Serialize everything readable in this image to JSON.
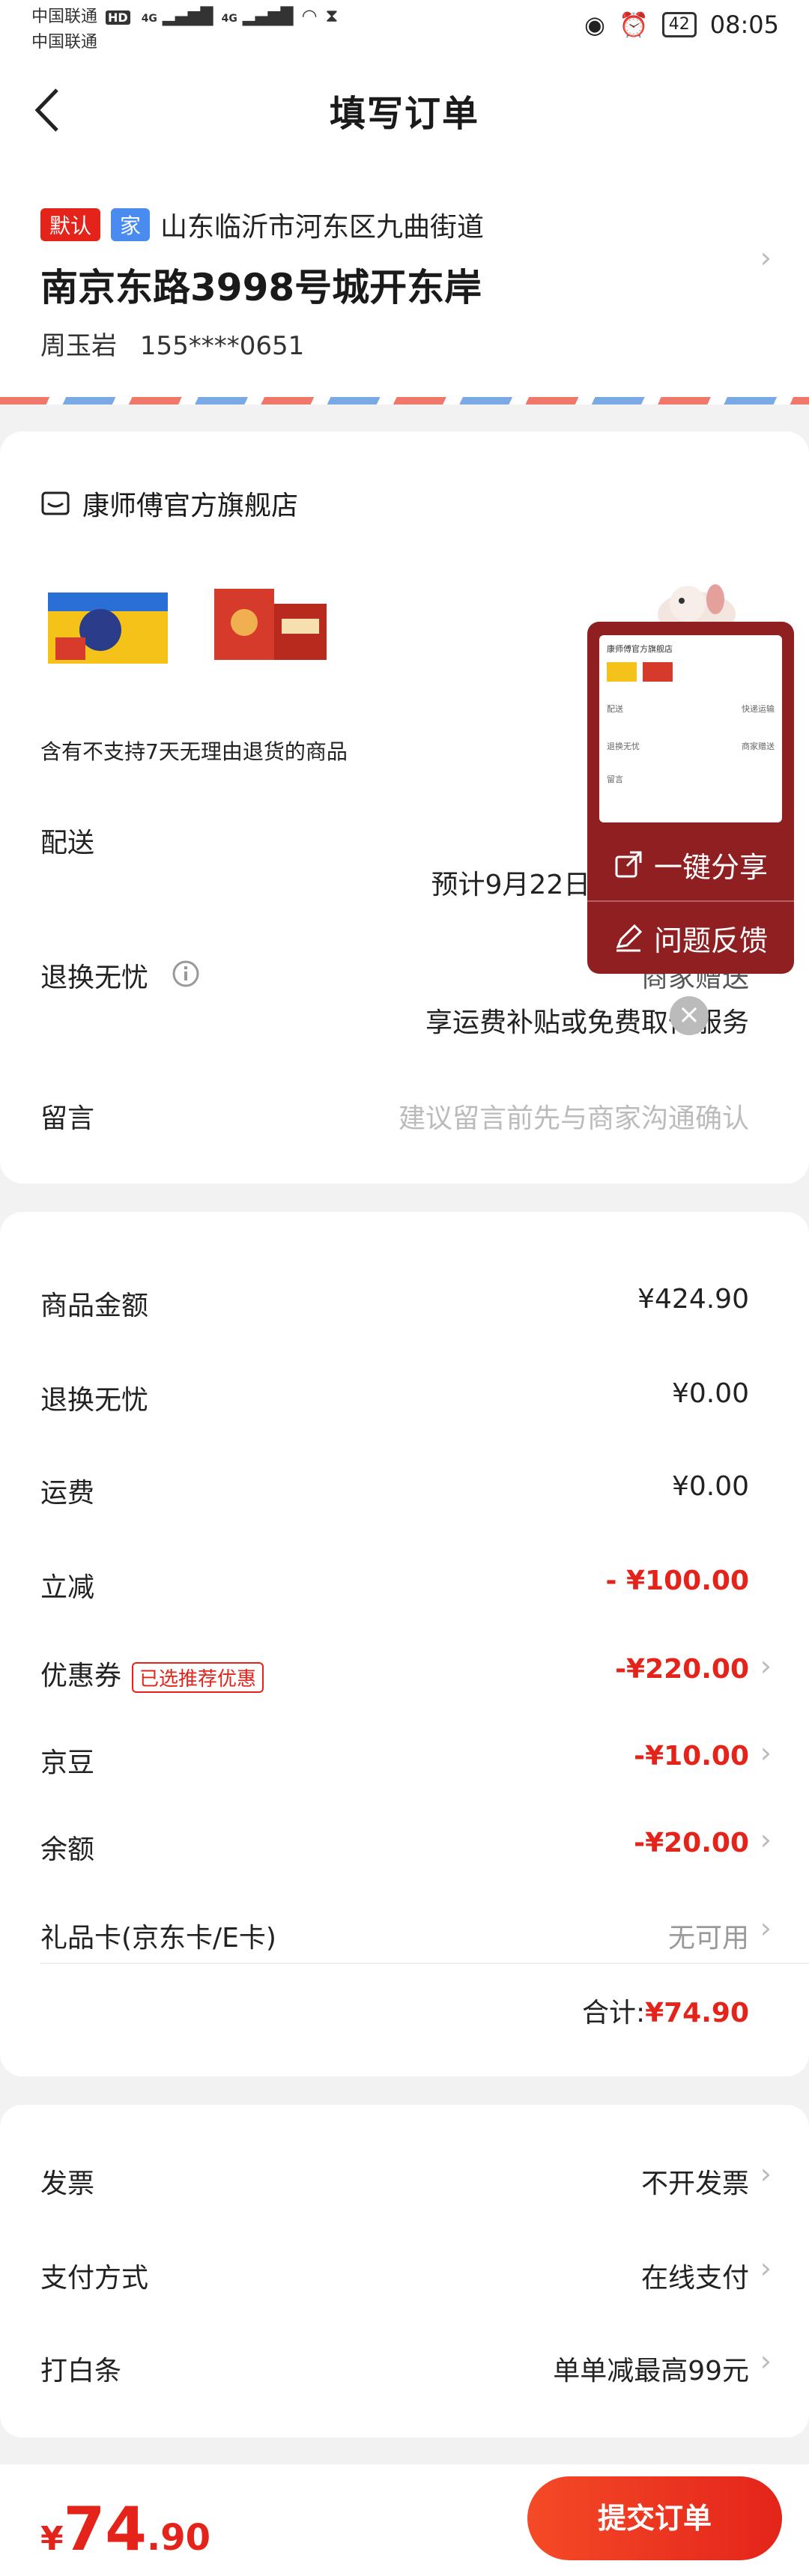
{
  "status_bar": {
    "carrier1": "中国联通",
    "hd": "HD",
    "net1": "4G",
    "net2": "4G",
    "carrier2": "中国联通",
    "battery": "42",
    "time": "08:05"
  },
  "nav": {
    "title": "填写订单",
    "back_icon": "chevron-left-icon"
  },
  "address": {
    "tag_default": "默认",
    "tag_home": "家",
    "region": "山东临沂市河东区九曲街道",
    "street": "南京东路3998号城开东岸",
    "name": "周玉岩",
    "phone": "155****0651",
    "colors": {
      "default_tag": "#e4241a",
      "home_tag": "#4a8bf0"
    }
  },
  "store": {
    "name": "康师傅官方旗舰店",
    "return_note": "含有不支持7天无理由退货的商品",
    "delivery_label": "配送",
    "delivery_value": "预计9月22日24:00前送达",
    "return_label": "退换无忧",
    "return_value": "商家赠送",
    "return_desc": "享运费补贴或免费取件服务",
    "message_label": "留言",
    "message_placeholder": "建议留言前先与商家沟通确认"
  },
  "popup": {
    "share": "一键分享",
    "feedback": "问题反馈",
    "thumb_shop": "康师傅官方旗舰店",
    "thumb_row1_label": "配送",
    "thumb_row1_value": "快递运输",
    "thumb_row2_label": "退换无忧",
    "thumb_row2_value": "商家赠送",
    "thumb_row3_label": "留言"
  },
  "summary": {
    "rows": [
      {
        "label": "商品金额",
        "value": "¥424.90",
        "style": "normal"
      },
      {
        "label": "退换无忧",
        "value": "¥0.00",
        "style": "normal"
      },
      {
        "label": "运费",
        "value": "¥0.00",
        "style": "normal"
      },
      {
        "label": "立减",
        "value": "- ¥100.00",
        "style": "red"
      },
      {
        "label": "优惠券",
        "value": "-¥220.00",
        "style": "red",
        "tag": "已选推荐优惠"
      },
      {
        "label": "京豆",
        "value": "-¥10.00",
        "style": "red"
      },
      {
        "label": "余额",
        "value": "-¥20.00",
        "style": "red"
      },
      {
        "label": "礼品卡(京东卡/E卡)",
        "value": "无可用",
        "style": "gray"
      }
    ],
    "total_label": "合计:",
    "total_value": "¥74.90"
  },
  "options": {
    "invoice_label": "发票",
    "invoice_value": "不开发票",
    "payment_label": "支付方式",
    "payment_value": "在线支付",
    "baitiao_label": "打白条",
    "baitiao_value": "单单减最高99元"
  },
  "bottom": {
    "currency": "¥",
    "price_int": "74",
    "price_dec": ".90",
    "submit": "提交订单"
  }
}
